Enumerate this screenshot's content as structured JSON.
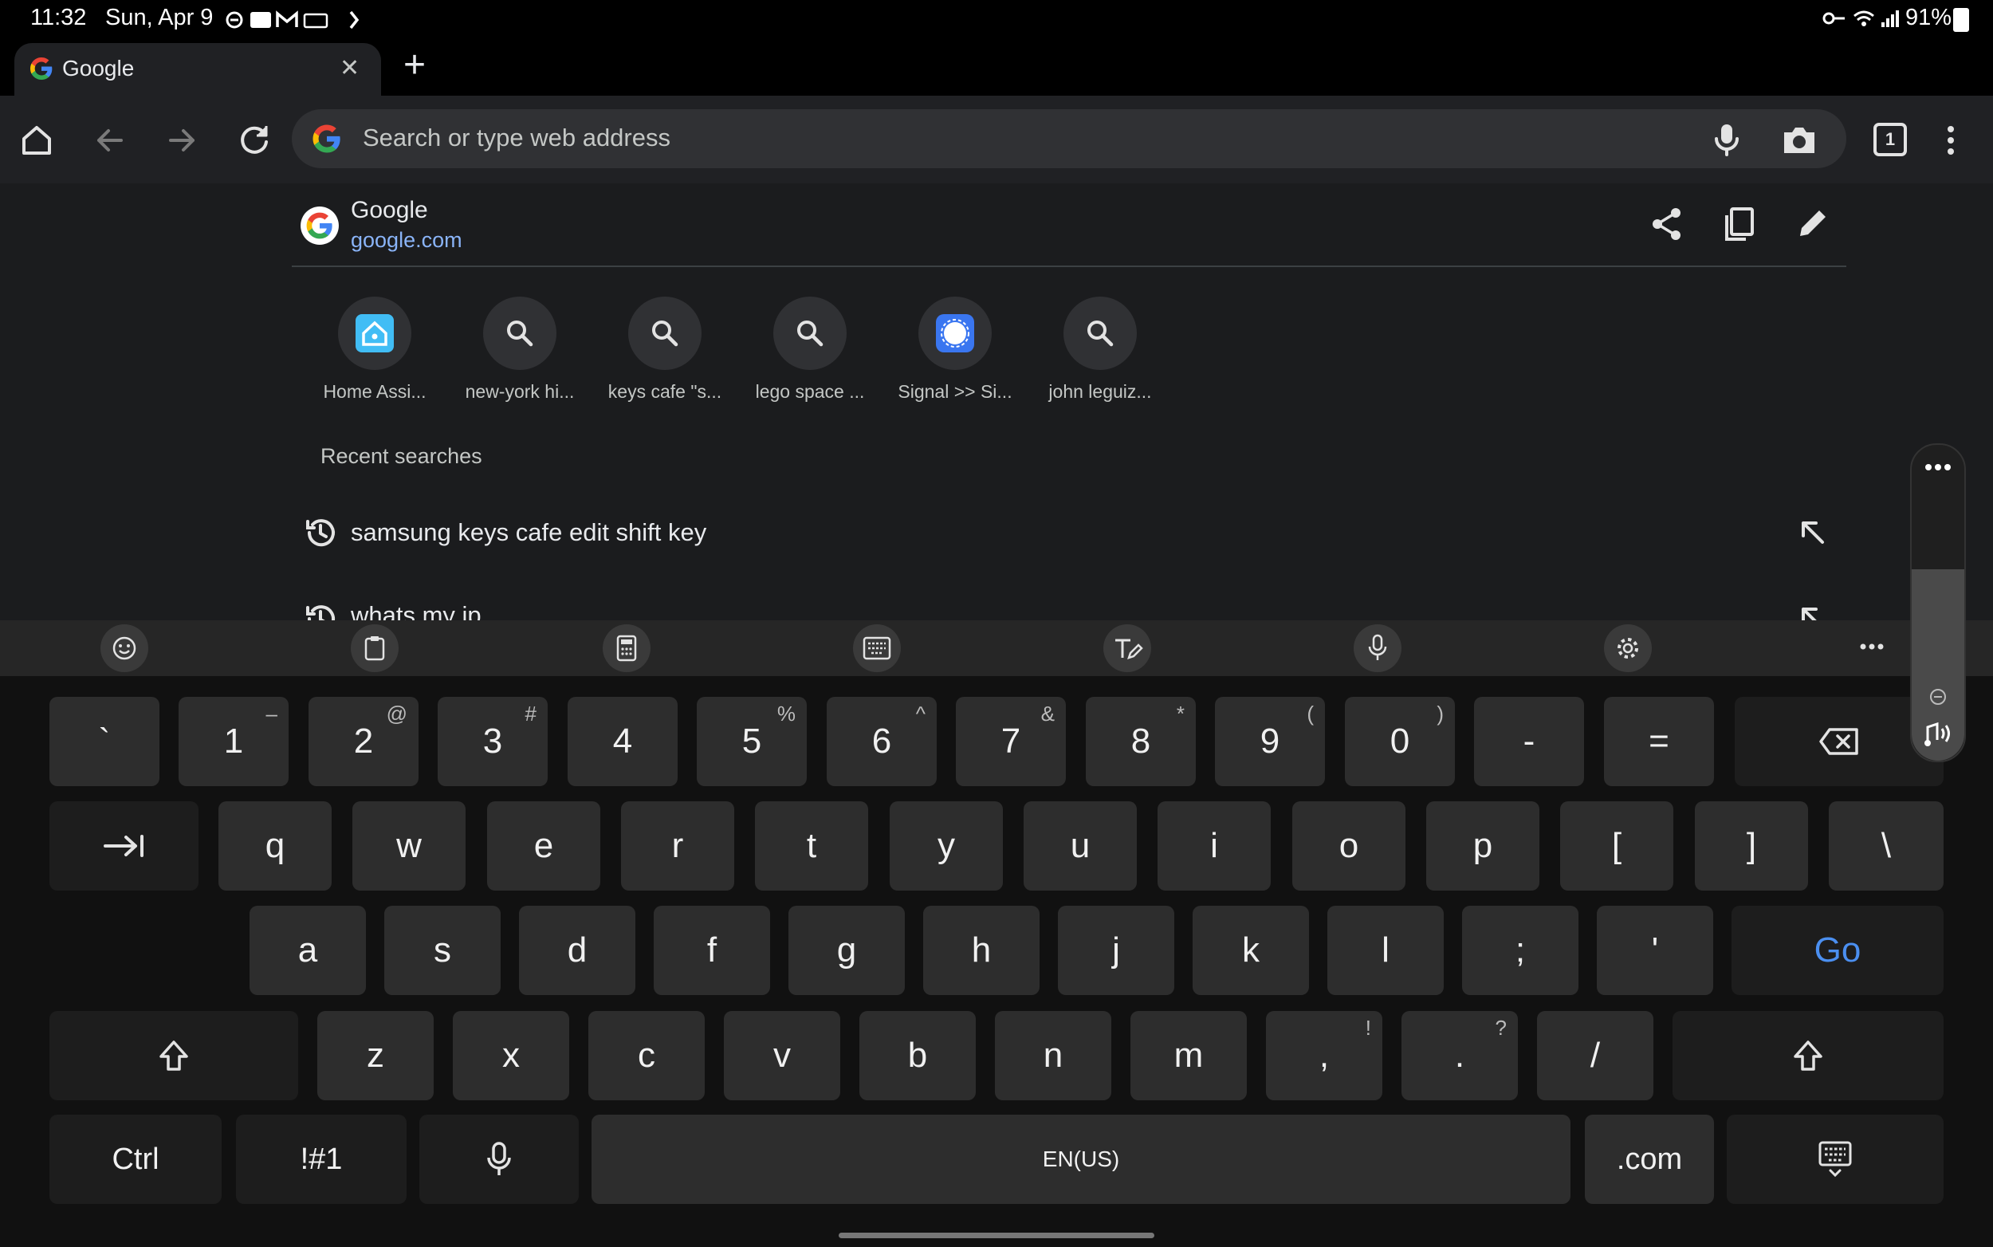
{
  "status_bar": {
    "time": "11:32",
    "date": "Sun, Apr 9",
    "battery": "91%"
  },
  "tab": {
    "title": "Google",
    "close": "✕",
    "new_tab": "+"
  },
  "toolbar": {
    "search_placeholder": "Search or type web address",
    "tab_count": "1"
  },
  "current_site": {
    "title": "Google",
    "url": "google.com"
  },
  "shortcuts": [
    {
      "label": "Home Assi...",
      "icon": "home-assistant-icon"
    },
    {
      "label": "new-york hi...",
      "icon": "search-icon"
    },
    {
      "label": "keys cafe \"s...",
      "icon": "search-icon"
    },
    {
      "label": "lego space ...",
      "icon": "search-icon"
    },
    {
      "label": "Signal >> Si...",
      "icon": "signal-icon"
    },
    {
      "label": "john leguiz...",
      "icon": "search-icon"
    }
  ],
  "recent": {
    "heading": "Recent searches",
    "items": [
      "samsung keys cafe edit shift key",
      "whats my ip"
    ]
  },
  "keyboard": {
    "row1": [
      {
        "k": "`",
        "s": ""
      },
      {
        "k": "1",
        "s": "–"
      },
      {
        "k": "2",
        "s": "@"
      },
      {
        "k": "3",
        "s": "#"
      },
      {
        "k": "4",
        "s": ""
      },
      {
        "k": "5",
        "s": "%"
      },
      {
        "k": "6",
        "s": "^"
      },
      {
        "k": "7",
        "s": "&"
      },
      {
        "k": "8",
        "s": "*"
      },
      {
        "k": "9",
        "s": "("
      },
      {
        "k": "0",
        "s": ")"
      },
      {
        "k": "-",
        "s": ""
      },
      {
        "k": "=",
        "s": ""
      }
    ],
    "row2": [
      "q",
      "w",
      "e",
      "r",
      "t",
      "y",
      "u",
      "i",
      "o",
      "p",
      "[",
      "]",
      "\\"
    ],
    "row3": [
      "a",
      "s",
      "d",
      "f",
      "g",
      "h",
      "j",
      "k",
      "l",
      ";",
      "'"
    ],
    "row4": [
      {
        "k": "z",
        "s": ""
      },
      {
        "k": "x",
        "s": ""
      },
      {
        "k": "c",
        "s": ""
      },
      {
        "k": "v",
        "s": ""
      },
      {
        "k": "b",
        "s": ""
      },
      {
        "k": "n",
        "s": ""
      },
      {
        "k": "m",
        "s": ""
      },
      {
        "k": ",",
        "s": "!"
      },
      {
        "k": ".",
        "s": "?"
      },
      {
        "k": "/",
        "s": ""
      }
    ],
    "go": "Go",
    "ctrl": "Ctrl",
    "sym": "!#1",
    "space": "EN(US)",
    "dotcom": ".com"
  }
}
